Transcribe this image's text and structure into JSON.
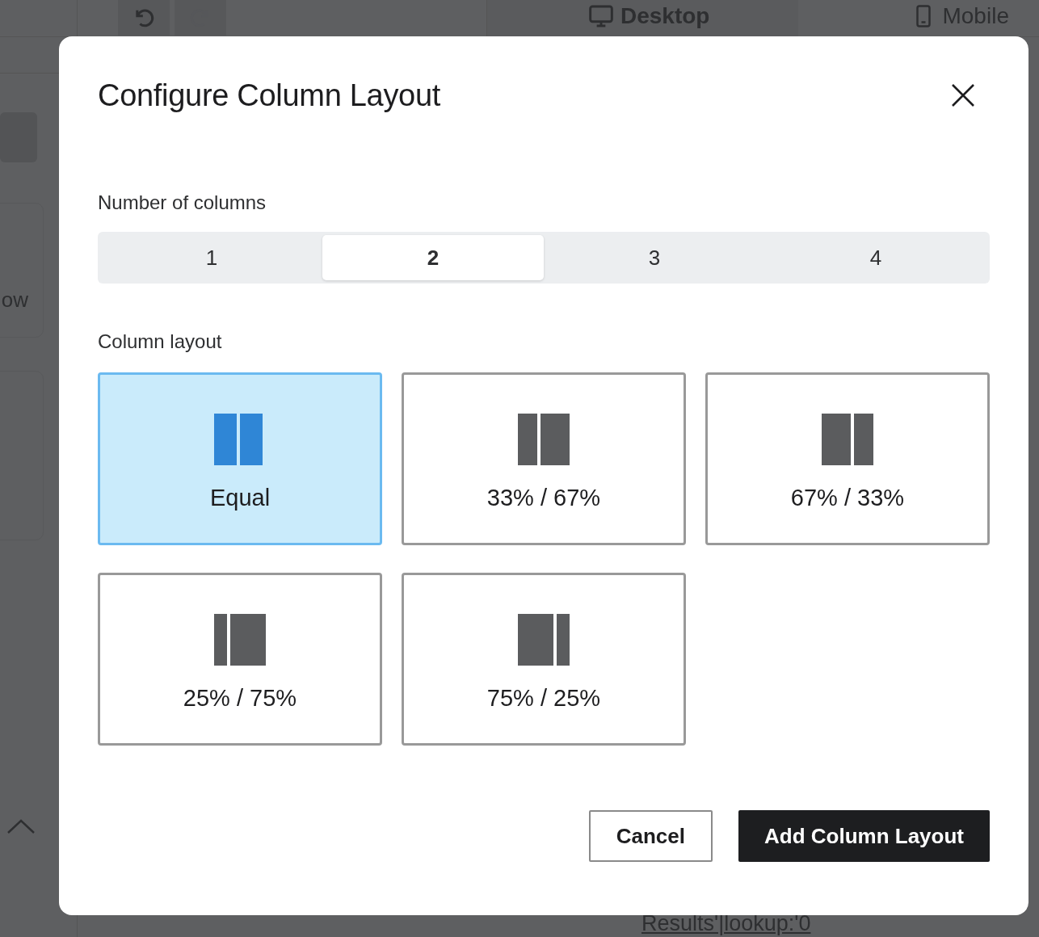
{
  "background": {
    "toolbar": {
      "views": [
        {
          "kind": "desktop",
          "label": "Desktop",
          "selected": true
        },
        {
          "kind": "mobile",
          "label": "Mobile",
          "selected": false
        }
      ]
    },
    "side_text": "ow",
    "footer_text": "Results'|lookup:'0"
  },
  "dialog": {
    "title": "Configure Column Layout",
    "columns_label": "Number of columns",
    "column_counts": [
      {
        "label": "1",
        "selected": false
      },
      {
        "label": "2",
        "selected": true
      },
      {
        "label": "3",
        "selected": false
      },
      {
        "label": "4",
        "selected": false
      }
    ],
    "layout_label": "Column layout",
    "layouts": [
      {
        "kind": "equal",
        "label": "Equal",
        "selected": true
      },
      {
        "kind": "narrowwide",
        "label": "33% / 67%",
        "selected": false
      },
      {
        "kind": "widenarrow",
        "label": "67% / 33%",
        "selected": false
      },
      {
        "kind": "slimwide",
        "label": "25% / 75%",
        "selected": false
      },
      {
        "kind": "wideslim",
        "label": "75% / 25%",
        "selected": false
      }
    ],
    "buttons": [
      {
        "kind": "secondary",
        "label": "Cancel"
      },
      {
        "kind": "primary",
        "label": "Add Column Layout"
      }
    ]
  }
}
